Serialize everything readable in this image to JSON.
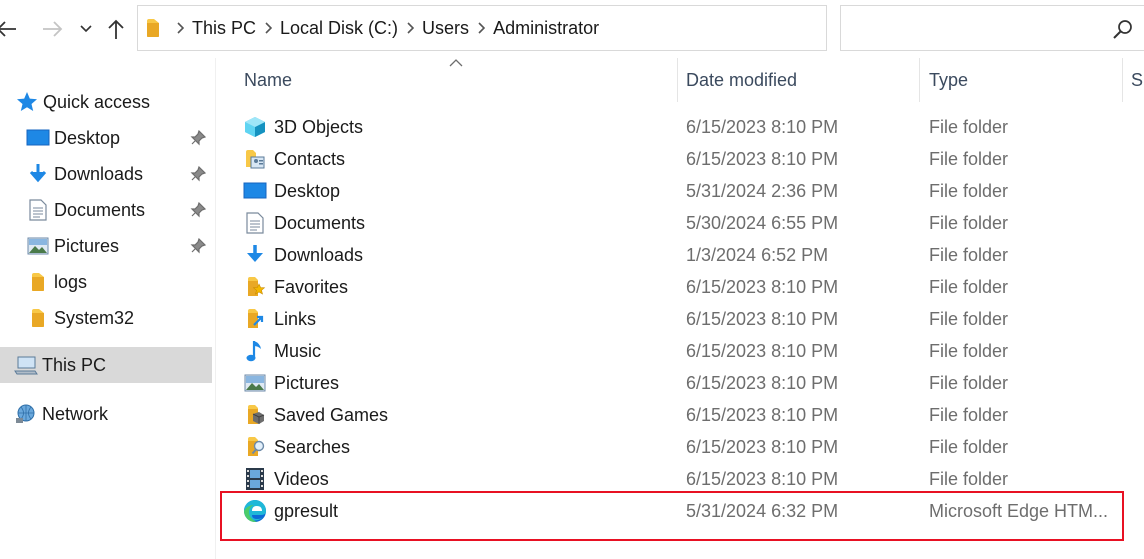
{
  "navigation": {
    "breadcrumb": [
      "This PC",
      "Local Disk (C:)",
      "Users",
      "Administrator"
    ],
    "search_placeholder": ""
  },
  "nav_pane": {
    "quick_access_label": "Quick access",
    "pinned": [
      {
        "label": "Desktop",
        "icon": "desktop-icon"
      },
      {
        "label": "Downloads",
        "icon": "downloads-icon"
      },
      {
        "label": "Documents",
        "icon": "documents-icon"
      },
      {
        "label": "Pictures",
        "icon": "pictures-icon"
      }
    ],
    "recent": [
      {
        "label": "logs",
        "icon": "folder-icon"
      },
      {
        "label": "System32",
        "icon": "folder-icon"
      }
    ],
    "this_pc_label": "This PC",
    "network_label": "Network"
  },
  "columns": {
    "name": "Name",
    "date_modified": "Date modified",
    "type": "Type",
    "size": "Si"
  },
  "files": [
    {
      "name": "3D Objects",
      "date": "6/15/2023 8:10 PM",
      "type": "File folder",
      "icon": "3d-objects-icon"
    },
    {
      "name": "Contacts",
      "date": "6/15/2023 8:10 PM",
      "type": "File folder",
      "icon": "contacts-icon"
    },
    {
      "name": "Desktop",
      "date": "5/31/2024 2:36 PM",
      "type": "File folder",
      "icon": "desktop-icon"
    },
    {
      "name": "Documents",
      "date": "5/30/2024 6:55 PM",
      "type": "File folder",
      "icon": "documents-icon"
    },
    {
      "name": "Downloads",
      "date": "1/3/2024 6:52 PM",
      "type": "File folder",
      "icon": "downloads-icon"
    },
    {
      "name": "Favorites",
      "date": "6/15/2023 8:10 PM",
      "type": "File folder",
      "icon": "favorites-icon"
    },
    {
      "name": "Links",
      "date": "6/15/2023 8:10 PM",
      "type": "File folder",
      "icon": "links-icon"
    },
    {
      "name": "Music",
      "date": "6/15/2023 8:10 PM",
      "type": "File folder",
      "icon": "music-icon"
    },
    {
      "name": "Pictures",
      "date": "6/15/2023 8:10 PM",
      "type": "File folder",
      "icon": "pictures-icon"
    },
    {
      "name": "Saved Games",
      "date": "6/15/2023 8:10 PM",
      "type": "File folder",
      "icon": "saved-games-icon"
    },
    {
      "name": "Searches",
      "date": "6/15/2023 8:10 PM",
      "type": "File folder",
      "icon": "searches-icon"
    },
    {
      "name": "Videos",
      "date": "6/15/2023 8:10 PM",
      "type": "File folder",
      "icon": "videos-icon"
    },
    {
      "name": "gpresult",
      "date": "5/31/2024 6:32 PM",
      "type": "Microsoft Edge HTM...",
      "icon": "edge-html-icon"
    }
  ],
  "colors": {
    "selected_nav_bg": "#d9d9d9",
    "highlight_border": "#e81123",
    "folder_yellow": "#f8c847",
    "accent_blue": "#1e88e5"
  }
}
